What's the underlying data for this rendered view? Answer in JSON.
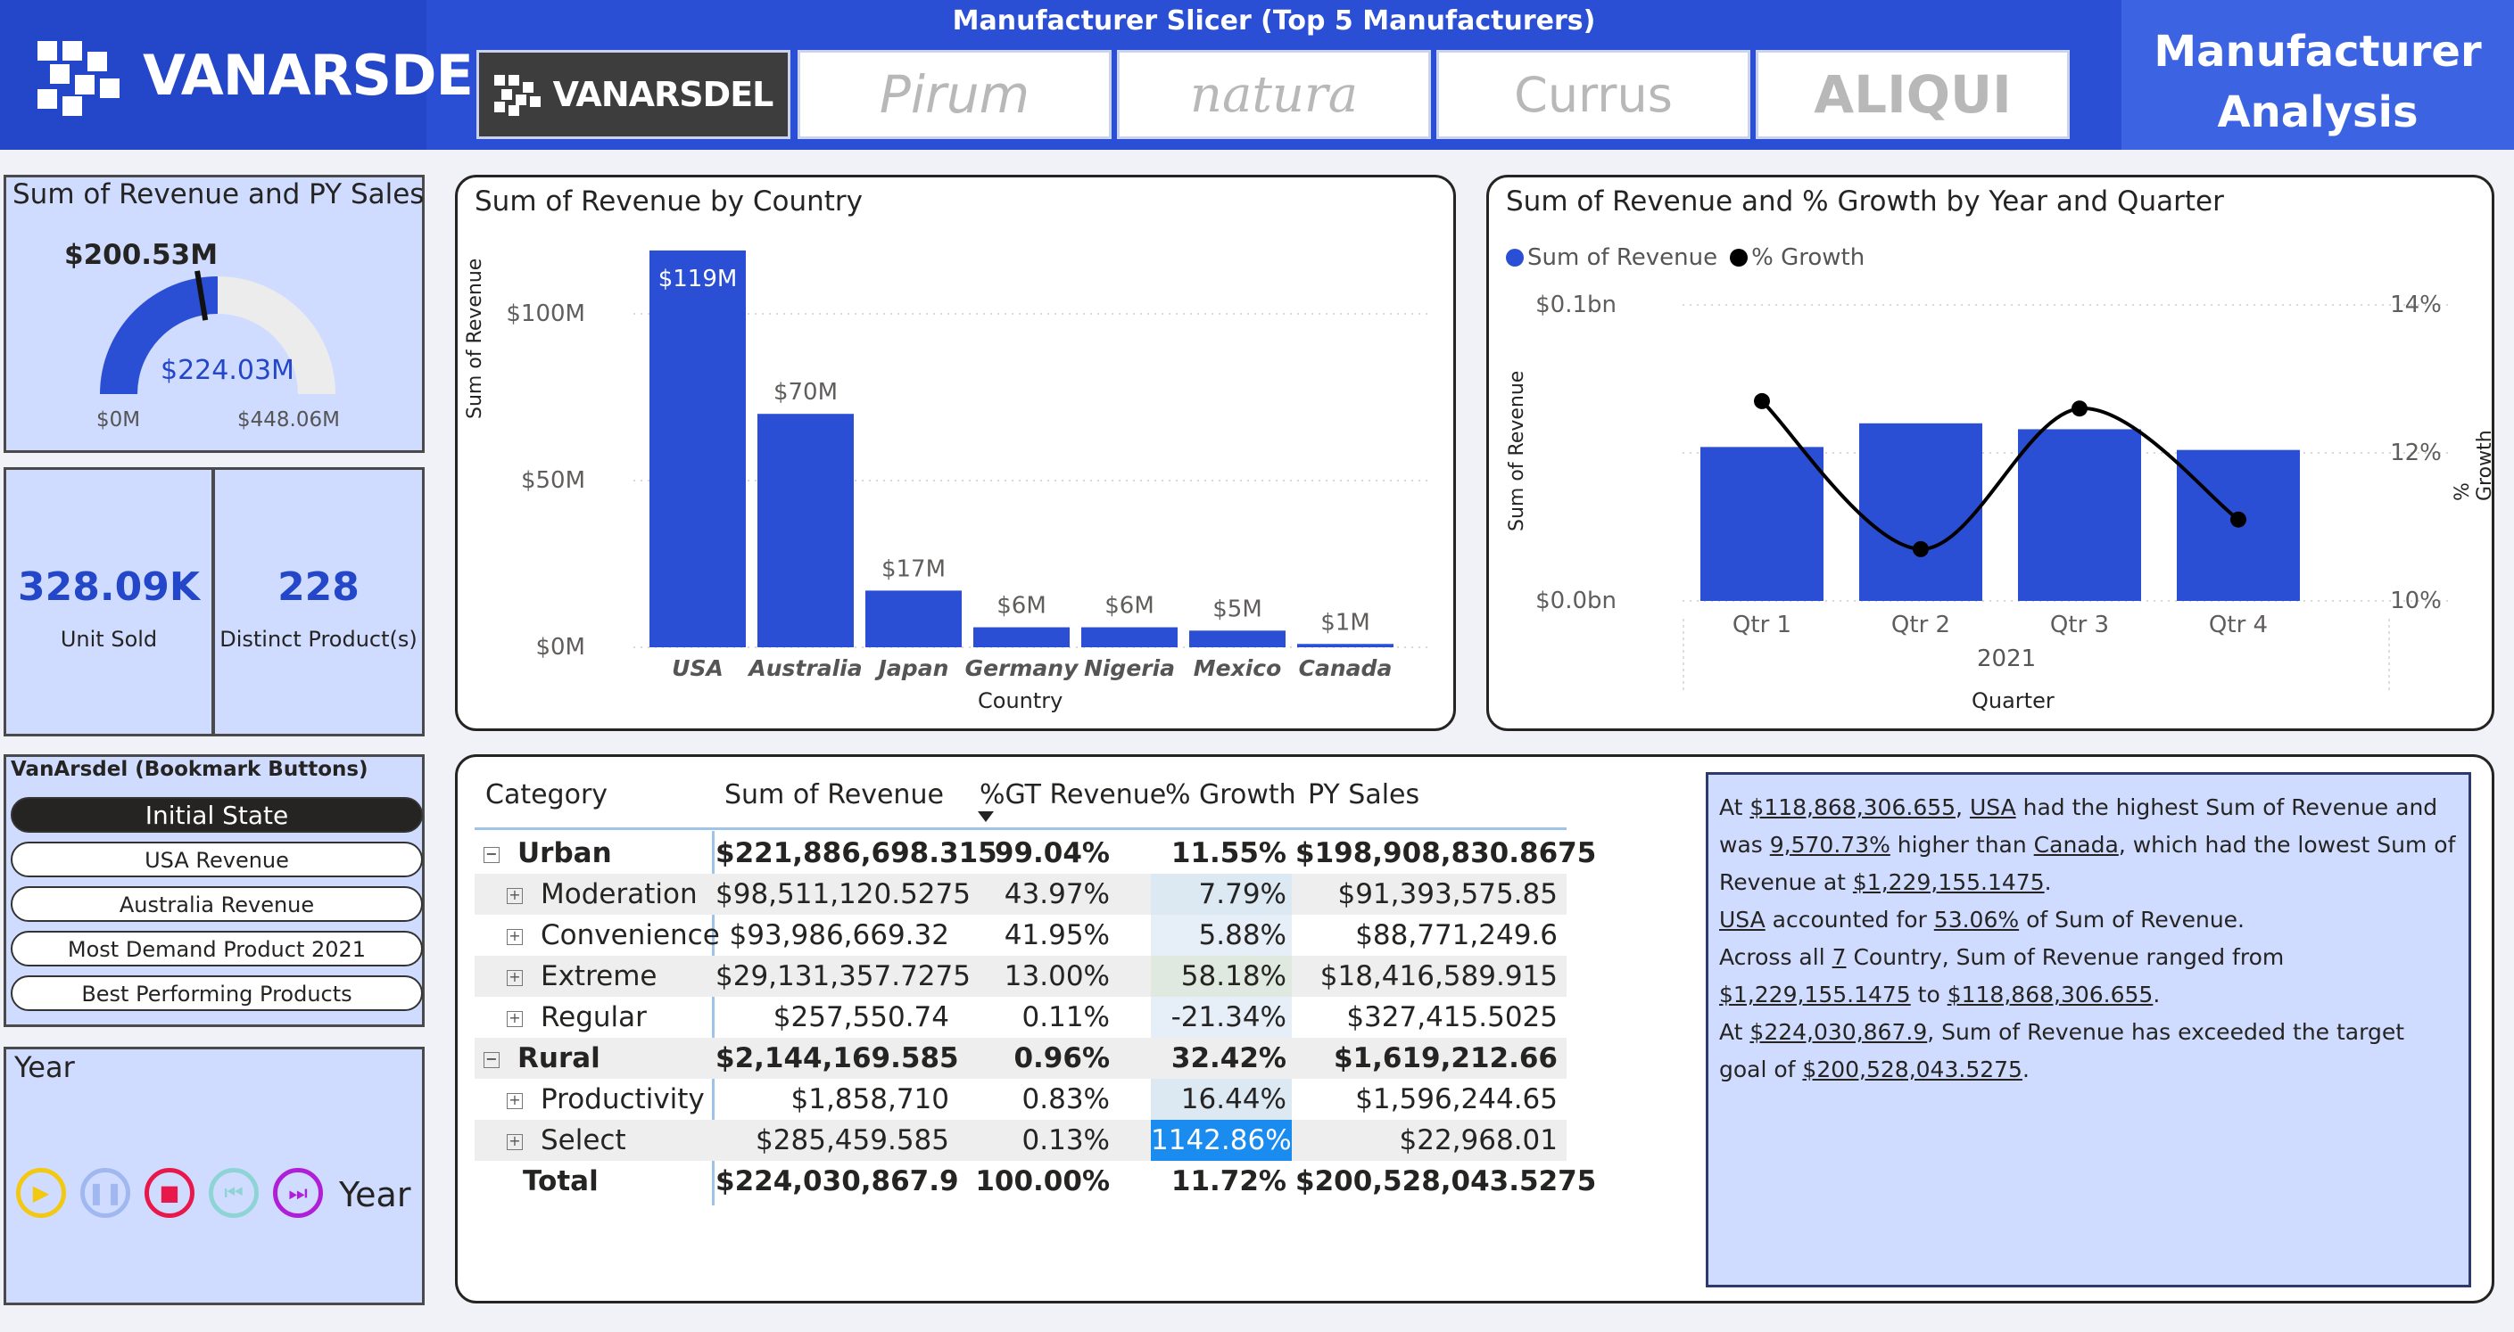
{
  "header": {
    "brand": "VANARSDEL",
    "slicer_title": "Manufacturer Slicer (Top 5 Manufacturers)",
    "manufacturers": [
      "VANARSDEL",
      "Pirum",
      "natura",
      "Currus",
      "ALIQUI"
    ],
    "selected_manufacturer": "VANARSDEL",
    "report_title_line1": "Manufacturer",
    "report_title_line2": "Analysis"
  },
  "gauge": {
    "title": "Sum of Revenue and PY Sales",
    "target_label": "$200.53M",
    "value_label": "$224.03M",
    "min_label": "$0M",
    "max_label": "$448.06M",
    "value": 224.03,
    "target": 200.53,
    "max": 448.06
  },
  "kpis": {
    "units_value": "328.09K",
    "units_label": "Unit Sold",
    "products_value": "228",
    "products_label": "Distinct Product(s)"
  },
  "bookmarks": {
    "title": "VanArsdel (Bookmark Buttons)",
    "buttons": [
      "Initial State",
      "USA Revenue",
      "Australia Revenue",
      "Most Demand Product 2021",
      "Best Performing Products"
    ],
    "active": "Initial State"
  },
  "year_slicer": {
    "title": "Year",
    "label": "Year"
  },
  "country_chart": {
    "title": "Sum of Revenue by Country",
    "xlabel": "Country",
    "ylabel": "Sum of Revenue",
    "y_ticks": [
      "$100M",
      "$50M",
      "$0M"
    ]
  },
  "quarter_chart": {
    "title": "Sum of Revenue and % Growth by Year and Quarter",
    "legend": [
      "Sum of Revenue",
      "% Growth"
    ],
    "y_left_ticks": [
      "$0.1bn",
      "$0.0bn"
    ],
    "y_right_ticks": [
      "14%",
      "12%",
      "10%"
    ],
    "ylabel_left": "Sum of Revenue",
    "ylabel_right": "% Growth",
    "xlabel": "Quarter",
    "year": "2021"
  },
  "chart_data": [
    {
      "type": "bar",
      "title": "Sum of Revenue by Country",
      "xlabel": "Country",
      "ylabel": "Sum of Revenue",
      "categories": [
        "USA",
        "Australia",
        "Japan",
        "Germany",
        "Nigeria",
        "Mexico",
        "Canada"
      ],
      "values": [
        119,
        70,
        17,
        6,
        6,
        5,
        1
      ],
      "data_labels": [
        "$119M",
        "$70M",
        "$17M",
        "$6M",
        "$6M",
        "$5M",
        "$1M"
      ],
      "unit": "$M",
      "ylim": [
        0,
        120
      ],
      "grid": true,
      "bar_color": "#2b4fd4"
    },
    {
      "type": "bar",
      "title": "Sum of Revenue and % Growth by Year and Quarter",
      "categories": [
        "Qtr 1",
        "Qtr 2",
        "Qtr 3",
        "Qtr 4"
      ],
      "series": [
        {
          "name": "Sum of Revenue",
          "type": "bar",
          "values": [
            0.052,
            0.06,
            0.058,
            0.051
          ],
          "unit": "$bn",
          "axis": "left"
        },
        {
          "name": "% Growth",
          "type": "line",
          "values": [
            12.7,
            10.7,
            12.6,
            11.1
          ],
          "unit": "%",
          "axis": "right"
        }
      ],
      "ylim_left": [
        0,
        0.1
      ],
      "ylim_right": [
        10,
        14
      ],
      "legend_position": "top-left",
      "bar_color": "#2b4fd4",
      "line_color": "#000000"
    }
  ],
  "table": {
    "headers": [
      "Category",
      "Sum of Revenue",
      "%GT Revenue",
      "% Growth",
      "PY Sales"
    ],
    "rows": [
      {
        "label": "Urban",
        "level": 0,
        "revenue": "$221,886,698.315",
        "gt": "99.04%",
        "growth": "11.55%",
        "py": "$198,908,830.8675",
        "bold": true,
        "bg": false,
        "growth_color": ""
      },
      {
        "label": "Moderation",
        "level": 1,
        "revenue": "$98,511,120.5275",
        "gt": "43.97%",
        "growth": "7.79%",
        "py": "$91,393,575.85",
        "bold": false,
        "bg": true,
        "growth_color": "#dce9f2"
      },
      {
        "label": "Convenience",
        "level": 1,
        "revenue": "$93,986,669.32",
        "gt": "41.95%",
        "growth": "5.88%",
        "py": "$88,771,249.6",
        "bold": false,
        "bg": false,
        "growth_color": "#e6eff7"
      },
      {
        "label": "Extreme",
        "level": 1,
        "revenue": "$29,131,357.7275",
        "gt": "13.00%",
        "growth": "58.18%",
        "py": "$18,416,589.915",
        "bold": false,
        "bg": true,
        "growth_color": "#dfe9e0"
      },
      {
        "label": "Regular",
        "level": 1,
        "revenue": "$257,550.74",
        "gt": "0.11%",
        "growth": "-21.34%",
        "py": "$327,415.5025",
        "bold": false,
        "bg": false,
        "growth_color": "#e6eff7"
      },
      {
        "label": "Rural",
        "level": 0,
        "revenue": "$2,144,169.585",
        "gt": "0.96%",
        "growth": "32.42%",
        "py": "$1,619,212.66",
        "bold": true,
        "bg": true,
        "growth_color": ""
      },
      {
        "label": "Productivity",
        "level": 1,
        "revenue": "$1,858,710",
        "gt": "0.83%",
        "growth": "16.44%",
        "py": "$1,596,244.65",
        "bold": false,
        "bg": false,
        "growth_color": "#dce9f2"
      },
      {
        "label": "Select",
        "level": 1,
        "revenue": "$285,459.585",
        "gt": "0.13%",
        "growth": "1142.86%",
        "py": "$22,968.01",
        "bold": false,
        "bg": true,
        "growth_color": "#1a8cf0"
      }
    ],
    "total": {
      "label": "Total",
      "revenue": "$224,030,867.9",
      "gt": "100.00%",
      "growth": "11.72%",
      "py": "$200,528,043.5275"
    }
  },
  "narrative": {
    "p1_a": "At ",
    "p1_b": "$118,868,306.655",
    "p1_c": ", ",
    "p1_d": "USA",
    "p1_e": " had the highest Sum of Revenue and was ",
    "p1_f": "9,570.73%",
    "p1_g": " higher than ",
    "p1_h": "Canada",
    "p1_i": ", which had the lowest Sum of Revenue at ",
    "p1_j": "$1,229,155.1475",
    "p1_k": ".",
    "p2_a": "USA",
    "p2_b": " accounted for ",
    "p2_c": "53.06%",
    "p2_d": " of Sum of Revenue.",
    "p3_a": "Across all ",
    "p3_b": "7",
    "p3_c": " Country, Sum of Revenue ranged from ",
    "p3_d": "$1,229,155.1475",
    "p3_e": " to ",
    "p3_f": "$118,868,306.655",
    "p3_g": ".",
    "p4_a": "At ",
    "p4_b": "$224,030,867.9",
    "p4_c": ", Sum of Revenue has exceeded the target goal of ",
    "p4_d": "$200,528,043.5275",
    "p4_e": "."
  },
  "colors": {
    "brand_blue": "#2b4fd4",
    "panel_bg": "#cfdcff",
    "highlight_cell": "#1a8cf0"
  }
}
